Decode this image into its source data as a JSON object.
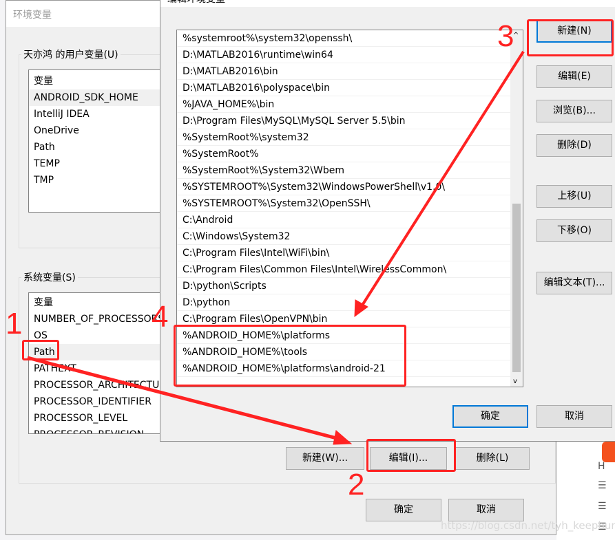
{
  "env_dialog": {
    "title": "环境变量",
    "user_group": "天亦鸿 的用户变量(U)",
    "user_header": "变量",
    "user_vars": [
      "ANDROID_SDK_HOME",
      "IntelliJ IDEA",
      "OneDrive",
      "Path",
      "TEMP",
      "TMP"
    ],
    "sys_group": "系统变量(S)",
    "sys_header": "变量",
    "sys_vars": [
      "NUMBER_OF_PROCESSORS",
      "OS",
      "Path",
      "PATHEXT",
      "PROCESSOR_ARCHITECTURE",
      "PROCESSOR_IDENTIFIER",
      "PROCESSOR_LEVEL",
      "PROCESSOR_REVISION"
    ],
    "new_btn": "新建(W)...",
    "edit_btn": "编辑(I)...",
    "delete_btn": "删除(L)",
    "ok_btn": "确定",
    "cancel_btn": "取消"
  },
  "edit_dialog": {
    "title": "编辑环境变量",
    "paths": [
      "%systemroot%\\system32\\openssh\\",
      "D:\\MATLAB2016\\runtime\\win64",
      "D:\\MATLAB2016\\bin",
      "D:\\MATLAB2016\\polyspace\\bin",
      "%JAVA_HOME%\\bin",
      "D:\\Program Files\\MySQL\\MySQL Server 5.5\\bin",
      "%SystemRoot%\\system32",
      "%SystemRoot%",
      "%SystemRoot%\\System32\\Wbem",
      "%SYSTEMROOT%\\System32\\WindowsPowerShell\\v1.0\\",
      "%SYSTEMROOT%\\System32\\OpenSSH\\",
      "C:\\Android",
      "C:\\Windows\\System32",
      "C:\\Program Files\\Intel\\WiFi\\bin\\",
      "C:\\Program Files\\Common Files\\Intel\\WirelessCommon\\",
      "D:\\python\\Scripts",
      "D:\\python",
      "C:\\Program Files\\OpenVPN\\bin",
      "%ANDROID_HOME%\\platforms",
      "%ANDROID_HOME%\\tools",
      "%ANDROID_HOME%\\platforms\\android-21"
    ],
    "buttons": [
      "新建(N)",
      "编辑(E)",
      "浏览(B)...",
      "删除(D)",
      "上移(U)",
      "下移(O)",
      "编辑文本(T)..."
    ],
    "ok_btn": "确定",
    "cancel_btn": "取消"
  },
  "annotations": [
    "1",
    "2",
    "3",
    "4"
  ],
  "watermark": "https://blog.csdn.net/tyh_keephunger",
  "annotation_color": "#ff2222"
}
